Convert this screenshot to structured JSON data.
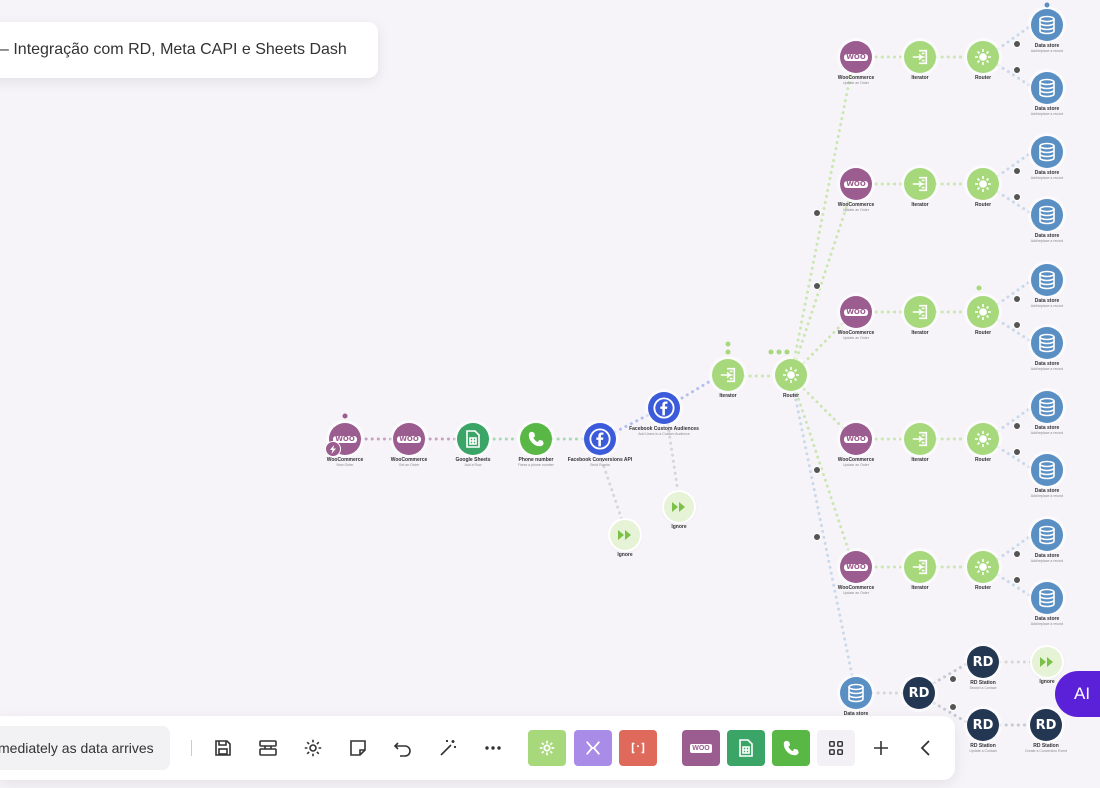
{
  "scenario": {
    "title": "– Integração com RD, Meta CAPI e Sheets Dash"
  },
  "colors": {
    "woo": "#9b5c8f",
    "sheets": "#3aa566",
    "phone": "#58b745",
    "facebook": "#3b5bdb",
    "flow": "#a7d97c",
    "datastore": "#5a8fc4",
    "rd": "#243752",
    "ignore": "#e6f3d6",
    "ai": "#5b21d9"
  },
  "node_texts": {
    "woo": "WOO",
    "rd": "RD"
  },
  "nodes": {
    "trigger": {
      "label": "WooCommerce",
      "sub": "New Order"
    },
    "woo_main": {
      "label": "WooCommerce",
      "sub": "Get an Order"
    },
    "sheets": {
      "label": "Google Sheets",
      "sub": "Add a Row"
    },
    "phone": {
      "label": "Phone number",
      "sub": "Parse a phone number"
    },
    "fb_capi": {
      "label": "Facebook Conversions API",
      "sub": "Send Events"
    },
    "fb_aud": {
      "label": "Facebook Custom Audiences",
      "sub": "Add Users to a Custom Audience"
    },
    "ignore_1": {
      "label": "Ignore",
      "sub": ""
    },
    "ignore_2": {
      "label": "Ignore",
      "sub": ""
    },
    "iterator_main": {
      "label": "Iterator",
      "sub": ""
    },
    "router_main": {
      "label": "Router",
      "sub": ""
    },
    "branch_woo_label": "WooCommerce",
    "branch_woo_sub": "Update an Order",
    "branch_iter_label": "Iterator",
    "branch_router_label": "Router",
    "branch_ds_label": "Data store",
    "branch_ds_sub": "Add/replace a record",
    "ds_bottom": {
      "label": "Data store",
      "sub": "Search records"
    },
    "rd_1": {
      "label": "RD Station",
      "sub": "Search a Contact"
    },
    "rd_2": {
      "label": "RD Station",
      "sub": "Update a Contact"
    },
    "rd_3": {
      "label": "RD Station",
      "sub": "Create a Conversion Event"
    },
    "rd_mid": {
      "label": "",
      "sub": ""
    },
    "ignore_3": {
      "label": "Ignore",
      "sub": ""
    }
  },
  "toolbar": {
    "schedule_text": "mediately as data arrives",
    "save": "save-icon",
    "variables": "variables-icon",
    "settings": "gear-icon",
    "notes": "note-icon",
    "history": "undo-icon",
    "autoalign": "magic-wand-icon",
    "more": "more-icon",
    "tools_tile": "gear-icon",
    "flow_control_tile": "flow-control-icon",
    "text_parser_tile": "text-parser-icon",
    "favorite_woo_label": "WOO",
    "favorite_sheets": "sheets-icon",
    "favorite_phone": "phone-icon",
    "apps": "grid-icon",
    "add": "plus-icon",
    "collapse": "chevron-left-icon"
  },
  "ai_button": {
    "label": "AI"
  }
}
